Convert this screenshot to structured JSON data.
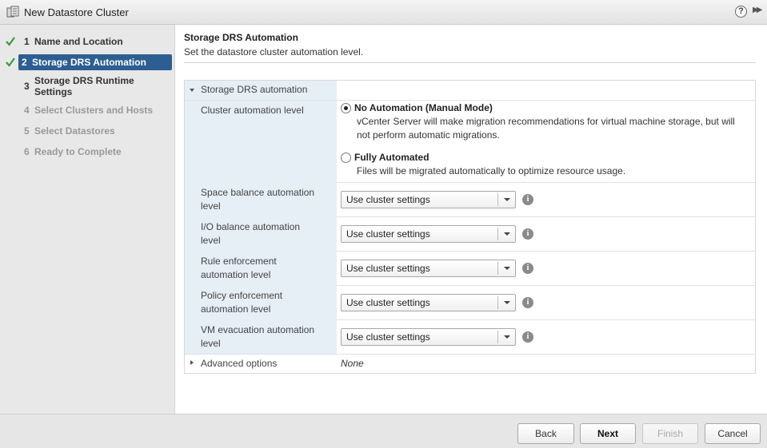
{
  "window": {
    "title": "New Datastore Cluster"
  },
  "steps": [
    {
      "num": "1",
      "label": "Name and Location",
      "state": "done"
    },
    {
      "num": "2",
      "label": "Storage DRS Automation",
      "state": "active"
    },
    {
      "num": "3",
      "label_line1": "Storage DRS Runtime",
      "label_line2": "Settings",
      "state": "pending"
    },
    {
      "num": "4",
      "label": "Select Clusters and Hosts",
      "state": "disabled"
    },
    {
      "num": "5",
      "label": "Select Datastores",
      "state": "disabled"
    },
    {
      "num": "6",
      "label": "Ready to Complete",
      "state": "disabled"
    }
  ],
  "page": {
    "title": "Storage DRS Automation",
    "subtitle": "Set the datastore cluster automation level."
  },
  "section": {
    "label": "Storage DRS automation"
  },
  "cluster_automation": {
    "label": "Cluster automation level",
    "options": [
      {
        "title": "No Automation (Manual Mode)",
        "desc_line1": "vCenter Server will make migration recommendations for virtual machine storage, but will",
        "desc_line2": "not perform automatic migrations.",
        "selected": true
      },
      {
        "title": "Fully Automated",
        "desc_line1": "Files will be migrated automatically to optimize resource usage.",
        "selected": false
      }
    ]
  },
  "settings": [
    {
      "label_line1": "Space balance automation",
      "label_line2": "level",
      "value": "Use cluster settings"
    },
    {
      "label_line1": "I/O balance automation",
      "label_line2": "level",
      "value": "Use cluster settings"
    },
    {
      "label_line1": "Rule enforcement",
      "label_line2": "automation level",
      "value": "Use cluster settings"
    },
    {
      "label_line1": "Policy enforcement",
      "label_line2": "automation level",
      "value": "Use cluster settings"
    },
    {
      "label_line1": "VM evacuation automation",
      "label_line2": "level",
      "value": "Use cluster settings"
    }
  ],
  "advanced": {
    "label": "Advanced options",
    "value": "None"
  },
  "buttons": {
    "back": "Back",
    "next": "Next",
    "finish": "Finish",
    "cancel": "Cancel"
  },
  "icons": {
    "help": "?",
    "info": "i"
  },
  "colors": {
    "active_step": "#2d5e91",
    "check": "#3c9a3c",
    "label_column": "#e6eef6"
  }
}
